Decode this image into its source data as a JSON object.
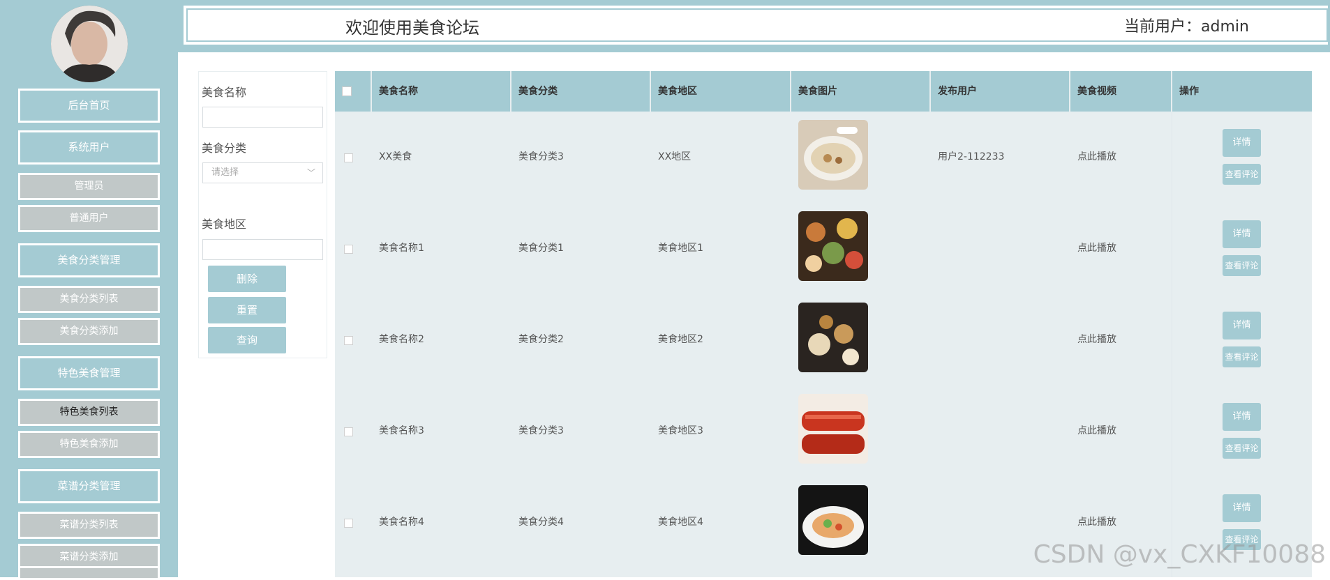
{
  "header": {
    "title": "欢迎使用美食论坛",
    "user_label": "当前用户：admin"
  },
  "sidebar": {
    "items": [
      {
        "label": "后台首页",
        "type": "main"
      },
      {
        "label": "系统用户",
        "type": "main"
      },
      {
        "label": "管理员",
        "type": "sub"
      },
      {
        "label": "普通用户",
        "type": "sub"
      },
      {
        "label": "美食分类管理",
        "type": "main"
      },
      {
        "label": "美食分类列表",
        "type": "sub"
      },
      {
        "label": "美食分类添加",
        "type": "sub"
      },
      {
        "label": "特色美食管理",
        "type": "main"
      },
      {
        "label": "特色美食列表",
        "type": "sub"
      },
      {
        "label": "特色美食添加",
        "type": "sub"
      },
      {
        "label": "菜谱分类管理",
        "type": "main"
      },
      {
        "label": "菜谱分类列表",
        "type": "sub"
      },
      {
        "label": "菜谱分类添加",
        "type": "sub"
      }
    ]
  },
  "search": {
    "name_label": "美食名称",
    "name_value": "",
    "category_label": "美食分类",
    "category_placeholder": "请选择",
    "region_label": "美食地区",
    "region_value": "",
    "delete_label": "删除",
    "reset_label": "重置",
    "query_label": "查询"
  },
  "table": {
    "columns": [
      "美食名称",
      "美食分类",
      "美食地区",
      "美食图片",
      "发布用户",
      "美食视频",
      "操作"
    ],
    "rows": [
      {
        "name": "XX美食",
        "category": "美食分类3",
        "region": "XX地区",
        "user": "用户2-112233",
        "video": "点此播放",
        "detail": "详情",
        "comment": "查看评论"
      },
      {
        "name": "美食名称1",
        "category": "美食分类1",
        "region": "美食地区1",
        "user": "",
        "video": "点此播放",
        "detail": "详情",
        "comment": "查看评论"
      },
      {
        "name": "美食名称2",
        "category": "美食分类2",
        "region": "美食地区2",
        "user": "",
        "video": "点此播放",
        "detail": "详情",
        "comment": "查看评论"
      },
      {
        "name": "美食名称3",
        "category": "美食分类3",
        "region": "美食地区3",
        "user": "",
        "video": "点此播放",
        "detail": "详情",
        "comment": "查看评论"
      },
      {
        "name": "美食名称4",
        "category": "美食分类4",
        "region": "美食地区4",
        "user": "",
        "video": "点此播放",
        "detail": "详情",
        "comment": "查看评论"
      }
    ]
  },
  "watermark": "CSDN @vx_CXKF10088"
}
